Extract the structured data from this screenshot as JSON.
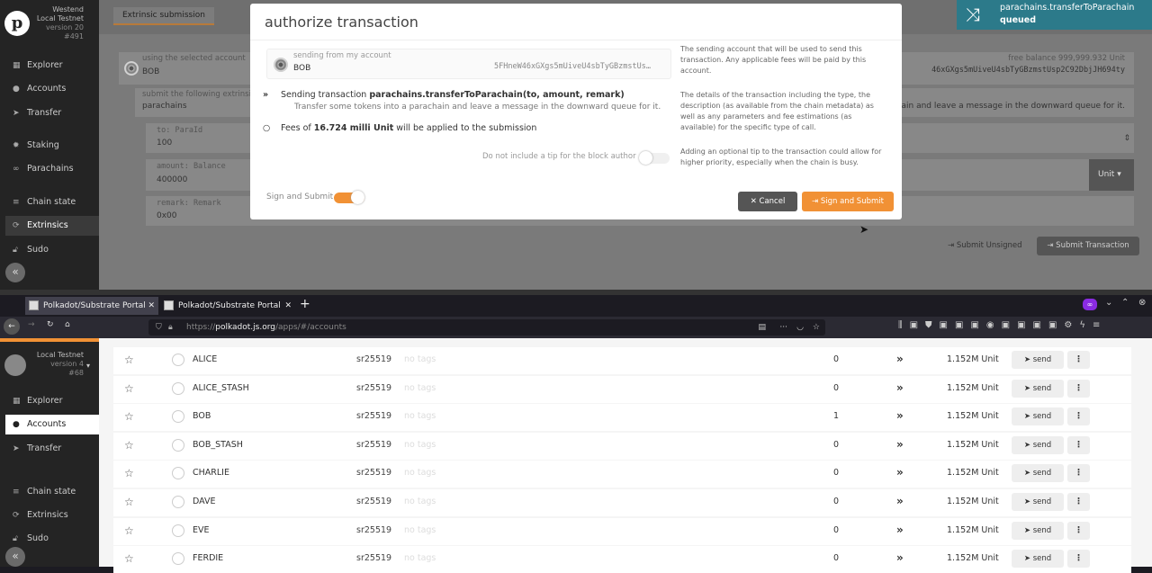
{
  "top_app": {
    "chain_name": "Westend Local Testnet",
    "version": "version 20",
    "block": "#491",
    "tab": "Extrinsic submission",
    "nav": [
      {
        "label": "Explorer",
        "icon": "grid-icon"
      },
      {
        "label": "Accounts",
        "icon": "users-icon"
      },
      {
        "label": "Transfer",
        "icon": "paper-plane-icon"
      },
      {
        "label": "Staking",
        "icon": "certificate-icon"
      },
      {
        "label": "Parachains",
        "icon": "link-icon"
      },
      {
        "label": "Chain state",
        "icon": "database-icon"
      },
      {
        "label": "Extrinsics",
        "icon": "sync-icon"
      },
      {
        "label": "Sudo",
        "icon": "unlock-icon"
      }
    ],
    "active_nav": "Extrinsics"
  },
  "background_form": {
    "using_label": "using the selected account",
    "account": "BOB",
    "balance": "free balance 999,999.932 Unit",
    "address": "46xGXgs5mUiveU4sbTyGBzmstUsp2C92DbjJH694ty",
    "submit_label": "submit the following extrinsic",
    "pallet": "parachains",
    "call_desc": "hain and leave a message in the downward queue for it.",
    "params": [
      {
        "label": "to: ParaId",
        "value": "100"
      },
      {
        "label": "amount: Balance",
        "value": "400000"
      },
      {
        "label": "remark: Remark",
        "value": "0x00"
      }
    ],
    "unit": "Unit",
    "submit_unsigned": "Submit Unsigned",
    "submit_transaction": "Submit Transaction"
  },
  "toast": {
    "title": "parachains.transferToParachain",
    "status": "queued"
  },
  "modal": {
    "title": "authorize transaction",
    "sending_label": "sending from my account",
    "account_name": "BOB",
    "account_address": "5FHneW46xGXgs5mUiveU4sbTyGBzmstUs…",
    "sending_prefix": "Sending transaction ",
    "call": "parachains.transferToParachain(to, amount, remark)",
    "call_desc": "Transfer some tokens into a parachain and leave a message in the downward queue for it.",
    "fees_prefix": "Fees of ",
    "fees_value": "16.724 milli Unit",
    "fees_suffix": " will be applied to the submission",
    "tip_label": "Do not include a tip for the block author",
    "help_account": "The sending account that will be used to send this transaction. Any applicable fees will be paid by this account.",
    "help_details": "The details of the transaction including the type, the description (as available from the chain metadata) as well as any parameters and fee estimations (as available) for the specific type of call.",
    "help_tip": "Adding an optional tip to the transaction could allow for higher priority, especially when the chain is busy.",
    "sign_toggle_label": "Sign and Submit",
    "cancel_label": "Cancel",
    "sign_label": "Sign and Submit"
  },
  "browser": {
    "tabs": [
      {
        "title": "Polkadot/Substrate Portal"
      },
      {
        "title": "Polkadot/Substrate Portal"
      }
    ],
    "url_prefix": "https://",
    "url_host": "polkadot.js.org",
    "url_path": "/apps/#/accounts"
  },
  "bottom_app": {
    "chain_name": "Local Testnet",
    "version": "version 4",
    "block": "#68",
    "nav": [
      {
        "label": "Explorer",
        "icon": "grid-icon"
      },
      {
        "label": "Accounts",
        "icon": "users-icon"
      },
      {
        "label": "Transfer",
        "icon": "paper-plane-icon"
      },
      {
        "label": "Chain state",
        "icon": "database-icon"
      },
      {
        "label": "Extrinsics",
        "icon": "sync-icon"
      },
      {
        "label": "Sudo",
        "icon": "unlock-icon"
      }
    ],
    "active_nav": "Accounts",
    "accounts": [
      {
        "name": "ALICE",
        "type": "sr25519",
        "tags": "no tags",
        "tx": "0",
        "balance": "1.152M Unit",
        "send": "send"
      },
      {
        "name": "ALICE_STASH",
        "type": "sr25519",
        "tags": "no tags",
        "tx": "0",
        "balance": "1.152M Unit",
        "send": "send"
      },
      {
        "name": "BOB",
        "type": "sr25519",
        "tags": "no tags",
        "tx": "1",
        "balance": "1.152M Unit",
        "send": "send"
      },
      {
        "name": "BOB_STASH",
        "type": "sr25519",
        "tags": "no tags",
        "tx": "0",
        "balance": "1.152M Unit",
        "send": "send"
      },
      {
        "name": "CHARLIE",
        "type": "sr25519",
        "tags": "no tags",
        "tx": "0",
        "balance": "1.152M Unit",
        "send": "send"
      },
      {
        "name": "DAVE",
        "type": "sr25519",
        "tags": "no tags",
        "tx": "0",
        "balance": "1.152M Unit",
        "send": "send"
      },
      {
        "name": "EVE",
        "type": "sr25519",
        "tags": "no tags",
        "tx": "0",
        "balance": "1.152M Unit",
        "send": "send"
      },
      {
        "name": "FERDIE",
        "type": "sr25519",
        "tags": "no tags",
        "tx": "0",
        "balance": "1.152M Unit",
        "send": "send"
      }
    ]
  },
  "colors": {
    "accent": "#f19135",
    "toast": "#2c7a8a"
  }
}
